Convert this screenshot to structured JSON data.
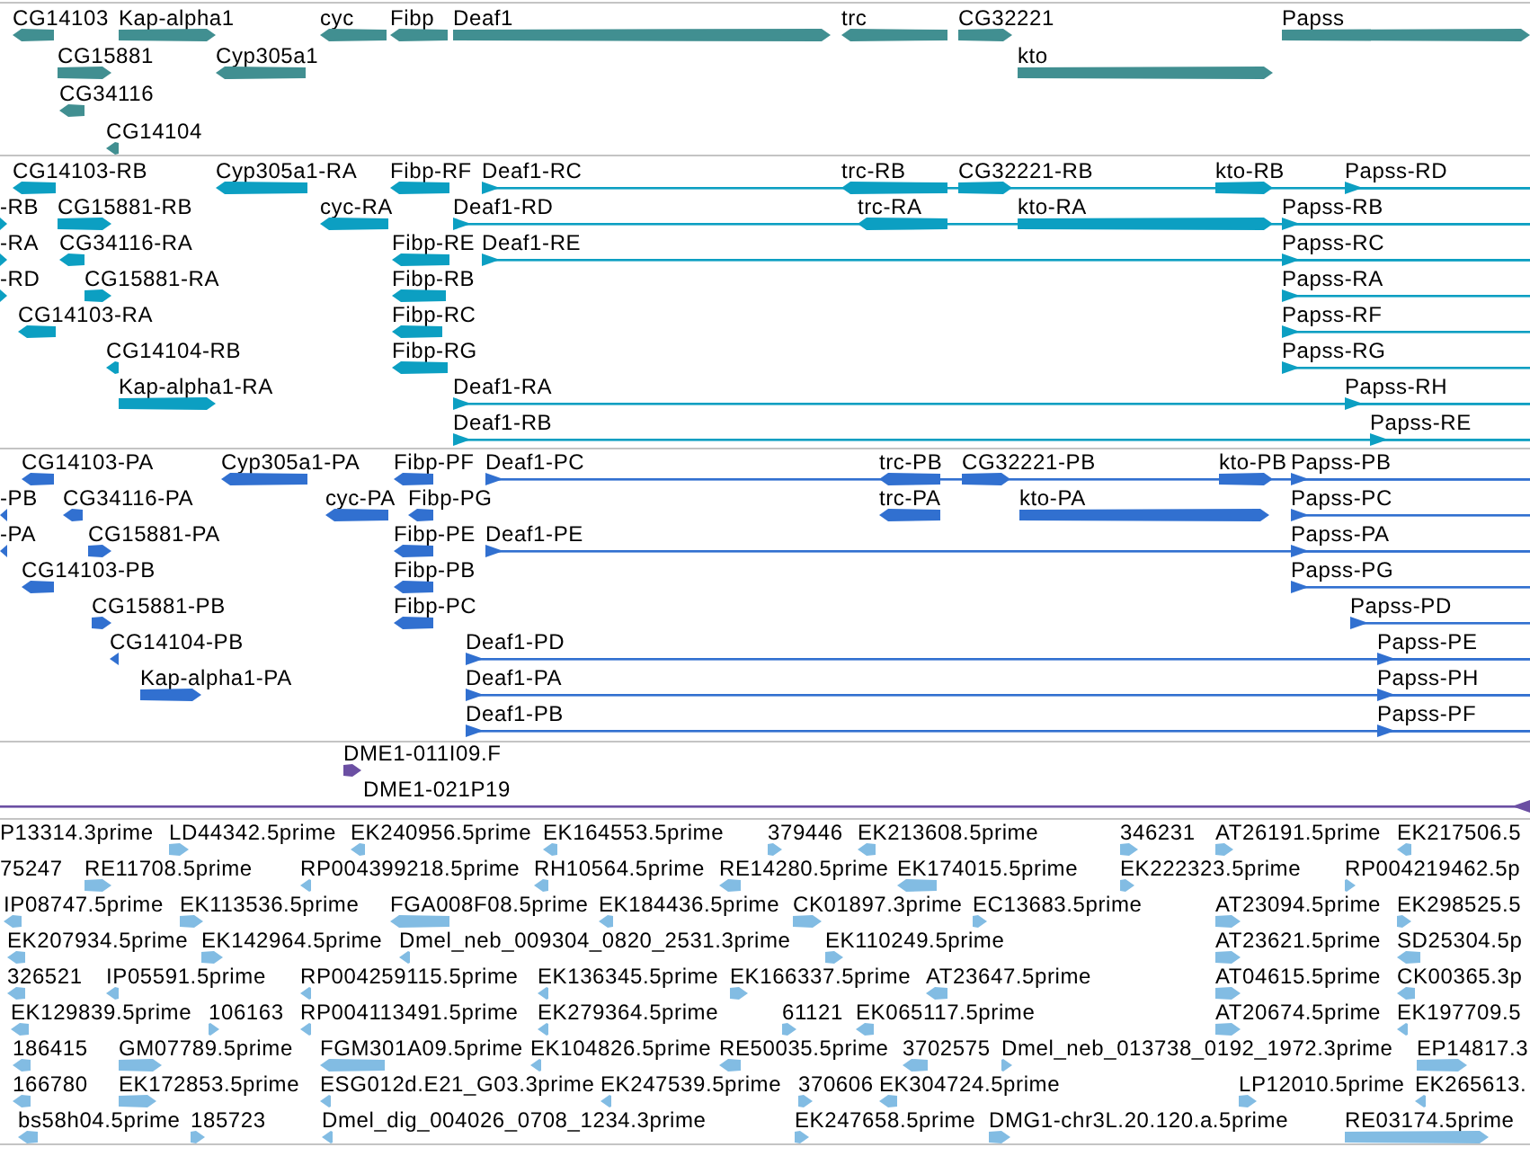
{
  "tracks": [
    {
      "kind": "gene",
      "features": [
        {
          "label": "CG14103"
        },
        {
          "label": "Kap-alpha1"
        },
        {
          "label": "cyc"
        },
        {
          "label": "Fibp"
        },
        {
          "label": "Deaf1"
        },
        {
          "label": "trc"
        },
        {
          "label": "CG32221"
        },
        {
          "label": "Papss"
        },
        {
          "label": "CG15881"
        },
        {
          "label": "Cyp305a1"
        },
        {
          "label": "kto"
        },
        {
          "label": "CG34116"
        },
        {
          "label": "CG14104"
        }
      ]
    },
    {
      "kind": "transcript",
      "features": [
        {
          "label": "CG14103-RB"
        },
        {
          "label": "Cyp305a1-RA"
        },
        {
          "label": "Fibp-RF"
        },
        {
          "label": "Deaf1-RC"
        },
        {
          "label": "trc-RB"
        },
        {
          "label": "CG32221-RB"
        },
        {
          "label": "kto-RB"
        },
        {
          "label": "Papss-RD"
        },
        {
          "label": "-RB"
        },
        {
          "label": "CG15881-RB"
        },
        {
          "label": "cyc-RA"
        },
        {
          "label": "Deaf1-RD"
        },
        {
          "label": "trc-RA"
        },
        {
          "label": "kto-RA"
        },
        {
          "label": "Papss-RB"
        },
        {
          "label": "-RA"
        },
        {
          "label": "CG34116-RA"
        },
        {
          "label": "Fibp-RE"
        },
        {
          "label": "Deaf1-RE"
        },
        {
          "label": "Papss-RC"
        },
        {
          "label": "-RD"
        },
        {
          "label": "CG15881-RA"
        },
        {
          "label": "Fibp-RB"
        },
        {
          "label": "Papss-RA"
        },
        {
          "label": "CG14103-RA"
        },
        {
          "label": "Fibp-RC"
        },
        {
          "label": "Papss-RF"
        },
        {
          "label": "CG14104-RB"
        },
        {
          "label": "Fibp-RG"
        },
        {
          "label": "Papss-RG"
        },
        {
          "label": "Kap-alpha1-RA"
        },
        {
          "label": "Deaf1-RA"
        },
        {
          "label": "Papss-RH"
        },
        {
          "label": "Deaf1-RB"
        },
        {
          "label": "Papss-RE"
        }
      ]
    },
    {
      "kind": "protein",
      "features": [
        {
          "label": "CG14103-PA"
        },
        {
          "label": "Cyp305a1-PA"
        },
        {
          "label": "Fibp-PF"
        },
        {
          "label": "Deaf1-PC"
        },
        {
          "label": "trc-PB"
        },
        {
          "label": "CG32221-PB"
        },
        {
          "label": "kto-PB"
        },
        {
          "label": "Papss-PB"
        },
        {
          "label": "-PB"
        },
        {
          "label": "CG34116-PA"
        },
        {
          "label": "cyc-PA"
        },
        {
          "label": "Fibp-PG"
        },
        {
          "label": "trc-PA"
        },
        {
          "label": "kto-PA"
        },
        {
          "label": "Papss-PC"
        },
        {
          "label": "-PA"
        },
        {
          "label": "CG15881-PA"
        },
        {
          "label": "Fibp-PE"
        },
        {
          "label": "Deaf1-PE"
        },
        {
          "label": "Papss-PA"
        },
        {
          "label": "CG14103-PB"
        },
        {
          "label": "Fibp-PB"
        },
        {
          "label": "Papss-PG"
        },
        {
          "label": "CG15881-PB"
        },
        {
          "label": "Fibp-PC"
        },
        {
          "label": "Papss-PD"
        },
        {
          "label": "CG14104-PB"
        },
        {
          "label": "Deaf1-PD"
        },
        {
          "label": "Papss-PE"
        },
        {
          "label": "Kap-alpha1-PA"
        },
        {
          "label": "Deaf1-PA"
        },
        {
          "label": "Papss-PH"
        },
        {
          "label": "Deaf1-PB"
        },
        {
          "label": "Papss-PF"
        }
      ]
    },
    {
      "kind": "clone",
      "features": [
        {
          "label": "DME1-011I09.F"
        },
        {
          "label": "DME1-021P19"
        }
      ]
    },
    {
      "kind": "est",
      "features": [
        {
          "label": "P13314.3prime"
        },
        {
          "label": "LD44342.5prime"
        },
        {
          "label": "EK240956.5prime"
        },
        {
          "label": "EK164553.5prime"
        },
        {
          "label": "379446"
        },
        {
          "label": "EK213608.5prime"
        },
        {
          "label": "346231"
        },
        {
          "label": "AT26191.5prime"
        },
        {
          "label": "EK217506.5"
        },
        {
          "label": "75247"
        },
        {
          "label": "RE11708.5prime"
        },
        {
          "label": "RP004399218.5prime"
        },
        {
          "label": "RH10564.5prime"
        },
        {
          "label": "RE14280.5prime"
        },
        {
          "label": "EK174015.5prime"
        },
        {
          "label": "EK222323.5prime"
        },
        {
          "label": "RP004219462.5p"
        },
        {
          "label": "IP08747.5prime"
        },
        {
          "label": "EK113536.5prime"
        },
        {
          "label": "FGA008F08.5prime"
        },
        {
          "label": "EK184436.5prime"
        },
        {
          "label": "CK01897.3prime"
        },
        {
          "label": "EC13683.5prime"
        },
        {
          "label": "AT23094.5prime"
        },
        {
          "label": "EK298525.5"
        },
        {
          "label": "EK207934.5prime"
        },
        {
          "label": "EK142964.5prime"
        },
        {
          "label": "Dmel_neb_009304_0820_2531.3prime"
        },
        {
          "label": "EK110249.5prime"
        },
        {
          "label": "AT23621.5prime"
        },
        {
          "label": "SD25304.5p"
        },
        {
          "label": "326521"
        },
        {
          "label": "IP05591.5prime"
        },
        {
          "label": "RP004259115.5prime"
        },
        {
          "label": "EK136345.5prime"
        },
        {
          "label": "EK166337.5prime"
        },
        {
          "label": "AT23647.5prime"
        },
        {
          "label": "AT04615.5prime"
        },
        {
          "label": "CK00365.3p"
        },
        {
          "label": "EK129839.5prime"
        },
        {
          "label": "106163"
        },
        {
          "label": "RP004113491.5prime"
        },
        {
          "label": "EK279364.5prime"
        },
        {
          "label": "61121"
        },
        {
          "label": "EK065117.5prime"
        },
        {
          "label": "AT20674.5prime"
        },
        {
          "label": "EK197709.5"
        },
        {
          "label": "186415"
        },
        {
          "label": "GM07789.5prime"
        },
        {
          "label": "FGM301A09.5prime"
        },
        {
          "label": "EK104826.5prime"
        },
        {
          "label": "RE50035.5prime"
        },
        {
          "label": "3702575"
        },
        {
          "label": "Dmel_neb_013738_0192_1972.3prime"
        },
        {
          "label": "EP14817.3"
        },
        {
          "label": "166780"
        },
        {
          "label": "EK172853.5prime"
        },
        {
          "label": "ESG012d.E21_G03.3prime"
        },
        {
          "label": "EK247539.5prime"
        },
        {
          "label": "370606"
        },
        {
          "label": "EK304724.5prime"
        },
        {
          "label": "LP12010.5prime"
        },
        {
          "label": "EK265613."
        },
        {
          "label": "bs58h04.5prime"
        },
        {
          "label": "185723"
        },
        {
          "label": "Dmel_dig_004026_0708_1234.3prime"
        },
        {
          "label": "EK247658.5prime"
        },
        {
          "label": "DMG1-chr3L.20.120.a.5prime"
        },
        {
          "label": "RE03174.5prime"
        }
      ]
    }
  ]
}
